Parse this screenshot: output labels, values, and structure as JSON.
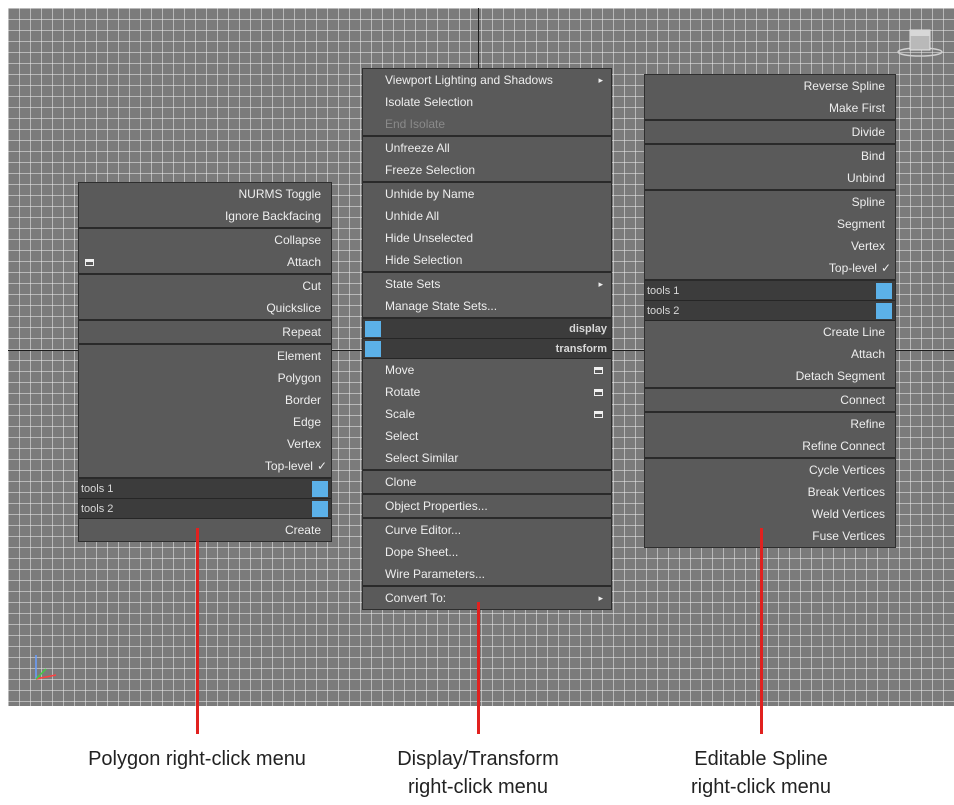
{
  "polygon_menu": {
    "sections": [
      [
        "NURMS Toggle",
        "Ignore Backfacing"
      ],
      [
        "Collapse",
        "Attach"
      ],
      [
        "Cut",
        "Quickslice"
      ],
      [
        "Repeat"
      ],
      [
        "Element",
        "Polygon",
        "Border",
        "Edge",
        "Vertex",
        "Top-level"
      ]
    ],
    "checkmark": "✓",
    "tools": [
      "tools 1",
      "tools 2"
    ],
    "create": "Create"
  },
  "display_menu": {
    "sections": [
      [
        "Viewport Lighting and Shadows",
        "Isolate Selection",
        "End Isolate"
      ],
      [
        "Unfreeze All",
        "Freeze Selection"
      ],
      [
        "Unhide by Name",
        "Unhide All",
        "Hide Unselected",
        "Hide Selection"
      ],
      [
        "State Sets",
        "Manage State Sets..."
      ]
    ],
    "quad_labels": [
      "display",
      "transform"
    ],
    "transform_items": [
      "Move",
      "Rotate",
      "Scale",
      "Select",
      "Select Similar"
    ],
    "clone": "Clone",
    "object_properties": "Object Properties...",
    "editors": [
      "Curve Editor...",
      "Dope Sheet...",
      "Wire Parameters..."
    ],
    "convert_to": "Convert To:",
    "arrow": "▸"
  },
  "spline_menu": {
    "sections": [
      [
        "Reverse Spline",
        "Make First"
      ],
      [
        "Divide"
      ],
      [
        "Bind",
        "Unbind"
      ],
      [
        "Spline",
        "Segment",
        "Vertex",
        "Top-level"
      ]
    ],
    "checkmark": "✓",
    "tools": [
      "tools 1",
      "tools 2"
    ],
    "after_tools": [
      [
        "Create Line",
        "Attach",
        "Detach Segment"
      ],
      [
        "Connect"
      ],
      [
        "Refine",
        "Refine Connect"
      ],
      [
        "Cycle Vertices",
        "Break Vertices",
        "Weld Vertices",
        "Fuse Vertices"
      ]
    ]
  },
  "captions": {
    "polygon": "Polygon right-click menu",
    "display_line1": "Display/Transform",
    "display_line2": "right-click menu",
    "spline_line1": "Editable Spline",
    "spline_line2": "right-click menu"
  },
  "colors": {
    "callout_line": "#e1211f",
    "quad_swatch": "#5cb1e8",
    "menu_bg": "#5a5a5a"
  },
  "icons": [
    "viewcube-icon",
    "axis-gizmo-icon",
    "submenu-arrow-icon",
    "settings-box-icon",
    "checkmark-icon"
  ]
}
